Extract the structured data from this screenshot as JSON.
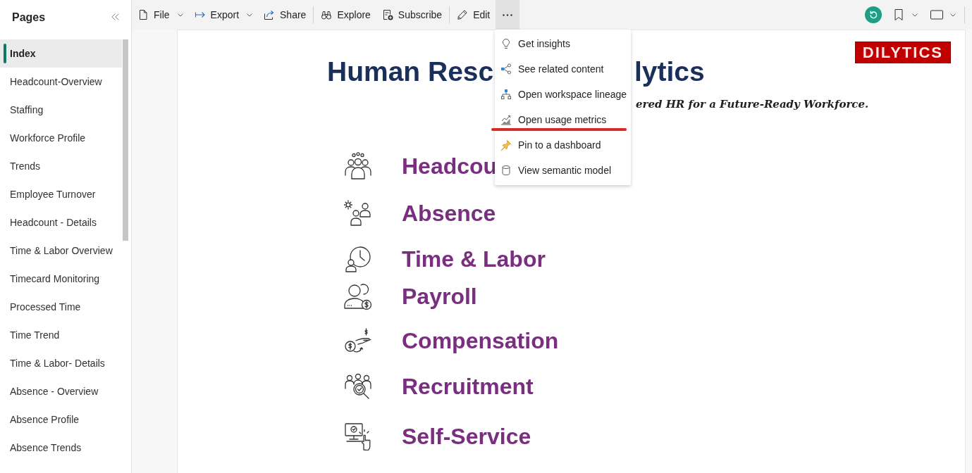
{
  "sidebar": {
    "title": "Pages",
    "pages": [
      {
        "label": "Index",
        "selected": true
      },
      {
        "label": "Headcount-Overview",
        "selected": false
      },
      {
        "label": "Staffing",
        "selected": false
      },
      {
        "label": "Workforce Profile",
        "selected": false
      },
      {
        "label": "Trends",
        "selected": false
      },
      {
        "label": "Employee Turnover",
        "selected": false
      },
      {
        "label": "Headcount - Details",
        "selected": false
      },
      {
        "label": "Time & Labor Overview",
        "selected": false
      },
      {
        "label": "Timecard Monitoring",
        "selected": false
      },
      {
        "label": "Processed Time",
        "selected": false
      },
      {
        "label": "Time Trend",
        "selected": false
      },
      {
        "label": "Time & Labor- Details",
        "selected": false
      },
      {
        "label": "Absence - Overview",
        "selected": false
      },
      {
        "label": "Absence Profile",
        "selected": false
      },
      {
        "label": "Absence Trends",
        "selected": false
      }
    ]
  },
  "toolbar": {
    "groups": [
      [
        {
          "label": "File",
          "kind": "dropdown"
        },
        {
          "label": "Export",
          "kind": "dropdown"
        },
        {
          "label": "Share",
          "kind": "button"
        }
      ],
      [
        {
          "label": "Explore",
          "kind": "button"
        },
        {
          "label": "Subscribe",
          "kind": "button"
        }
      ],
      [
        {
          "label": "Edit",
          "kind": "button"
        }
      ]
    ],
    "more_button": {
      "expanded": true
    }
  },
  "more_menu": {
    "items": [
      {
        "label": "Get insights",
        "underlined": false
      },
      {
        "label": "See related content",
        "underlined": false
      },
      {
        "label": "Open workspace lineage",
        "underlined": false
      },
      {
        "label": "Open usage metrics",
        "underlined": true
      },
      {
        "label": "Pin to a dashboard",
        "underlined": false
      },
      {
        "label": "View semantic model",
        "underlined": false
      }
    ]
  },
  "report": {
    "logo": "DILYTICS",
    "title_visible_start": "Human Resc",
    "title_visible_end": "lytics",
    "subtitle_visible_end": "ered HR for a Future-Ready Workforce.",
    "modules": [
      {
        "label": "Headcou"
      },
      {
        "label": "Absence"
      },
      {
        "label": "Time & Labor"
      },
      {
        "label": "Payroll"
      },
      {
        "label": "Compensation"
      },
      {
        "label": "Recruitment"
      },
      {
        "label": "Self-Service"
      }
    ]
  }
}
